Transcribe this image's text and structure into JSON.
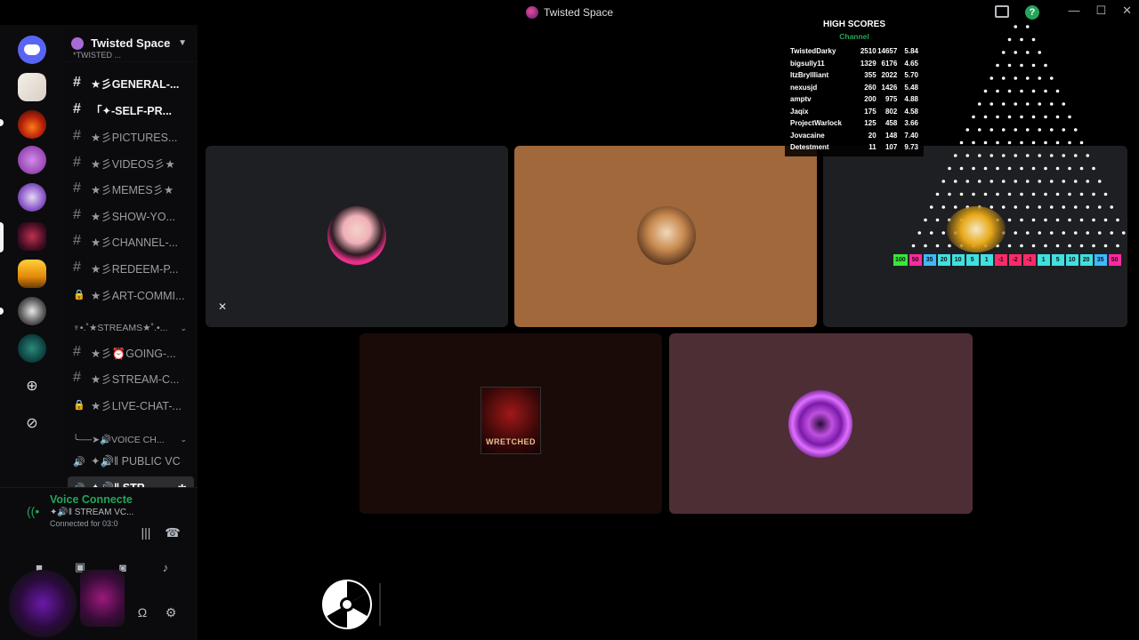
{
  "window": {
    "title": "Twisted Space"
  },
  "rail": {
    "badge_count": "1"
  },
  "sidebar": {
    "guild_name": "Twisted Space",
    "truncated_top": "*TWISTED ...",
    "channels": [
      {
        "label": "★彡GENERAL-...",
        "icon": "#",
        "state": "unread"
      },
      {
        "label": "「✦-SELF-PR...",
        "icon": "#",
        "state": "unread"
      },
      {
        "label": "★彡PICTURES...",
        "icon": "#",
        "state": "normal"
      },
      {
        "label": "★彡VIDEOS彡★",
        "icon": "#",
        "state": "normal"
      },
      {
        "label": "★彡MEMES彡★",
        "icon": "#",
        "state": "normal"
      },
      {
        "label": "★彡SHOW-YO...",
        "icon": "#",
        "state": "normal"
      },
      {
        "label": "★彡CHANNEL-...",
        "icon": "#",
        "state": "normal"
      },
      {
        "label": "★彡REDEEM-P...",
        "icon": "#",
        "state": "normal"
      },
      {
        "label": "★彡ART-COMMI...",
        "icon": "lock",
        "state": "normal"
      }
    ],
    "category_streams": "♆•.˚★STREAMS★˚.•...",
    "stream_channels": [
      {
        "label": "★彡⏰GOING-...",
        "icon": "#"
      },
      {
        "label": "★彡STREAM-C...",
        "icon": "#"
      },
      {
        "label": "★彡LIVE-CHAT-...",
        "icon": "lock"
      }
    ],
    "category_voice": "╰──➤🔊VOICE CH...",
    "voice_channels": [
      {
        "label": "✦🔊‖ PUBLIC VC",
        "state": "normal"
      },
      {
        "label": "✦🔊‖ STR...",
        "state": "active"
      }
    ]
  },
  "voice_panel": {
    "status": "Voice Connecte",
    "channel": "✦🔊‖ STREAM VC...",
    "connected": "Connected for 03:0"
  },
  "high_scores": {
    "title": "HIGH SCORES",
    "subtitle": "Channel",
    "rows": [
      {
        "name": "TwistedDarky",
        "a": "2510",
        "b": "14657",
        "c": "5.84"
      },
      {
        "name": "bigsully11",
        "a": "1329",
        "b": "6176",
        "c": "4.65"
      },
      {
        "name": "ItzBryllliant",
        "a": "355",
        "b": "2022",
        "c": "5.70"
      },
      {
        "name": "nexusjd",
        "a": "260",
        "b": "1426",
        "c": "5.48"
      },
      {
        "name": "amptv",
        "a": "200",
        "b": "975",
        "c": "4.88"
      },
      {
        "name": "Jaqix",
        "a": "175",
        "b": "802",
        "c": "4.58"
      },
      {
        "name": "ProjectWarlock",
        "a": "125",
        "b": "458",
        "c": "3.66"
      },
      {
        "name": "Jovacaine",
        "a": "20",
        "b": "148",
        "c": "7.40"
      },
      {
        "name": "Detestment",
        "a": "11",
        "b": "107",
        "c": "9.73"
      }
    ]
  },
  "plinko_bins": [
    {
      "v": "100",
      "color": "#39e639"
    },
    {
      "v": "50",
      "color": "#ff2aa0"
    },
    {
      "v": "35",
      "color": "#3fb8ff"
    },
    {
      "v": "20",
      "color": "#3fe0e0"
    },
    {
      "v": "10",
      "color": "#3fe0e0"
    },
    {
      "v": "5",
      "color": "#3fe0e0"
    },
    {
      "v": "1",
      "color": "#3fe0e0"
    },
    {
      "v": "-1",
      "color": "#ff2a6a"
    },
    {
      "v": "-2",
      "color": "#ff2a6a"
    },
    {
      "v": "-1",
      "color": "#ff2a6a"
    },
    {
      "v": "1",
      "color": "#3fe0e0"
    },
    {
      "v": "5",
      "color": "#3fe0e0"
    },
    {
      "v": "10",
      "color": "#3fe0e0"
    },
    {
      "v": "20",
      "color": "#3fe0e0"
    },
    {
      "v": "35",
      "color": "#3fb8ff"
    },
    {
      "v": "50",
      "color": "#ff2aa0"
    }
  ],
  "tile_label_wretched": "WRETCHED",
  "colors": {
    "accent_green": "#23a55a",
    "tile_orange": "#a0683b",
    "tile_mauve": "#4e2e35",
    "tile_dark": "#1e1f22",
    "tile_brown": "#1a0b08"
  }
}
